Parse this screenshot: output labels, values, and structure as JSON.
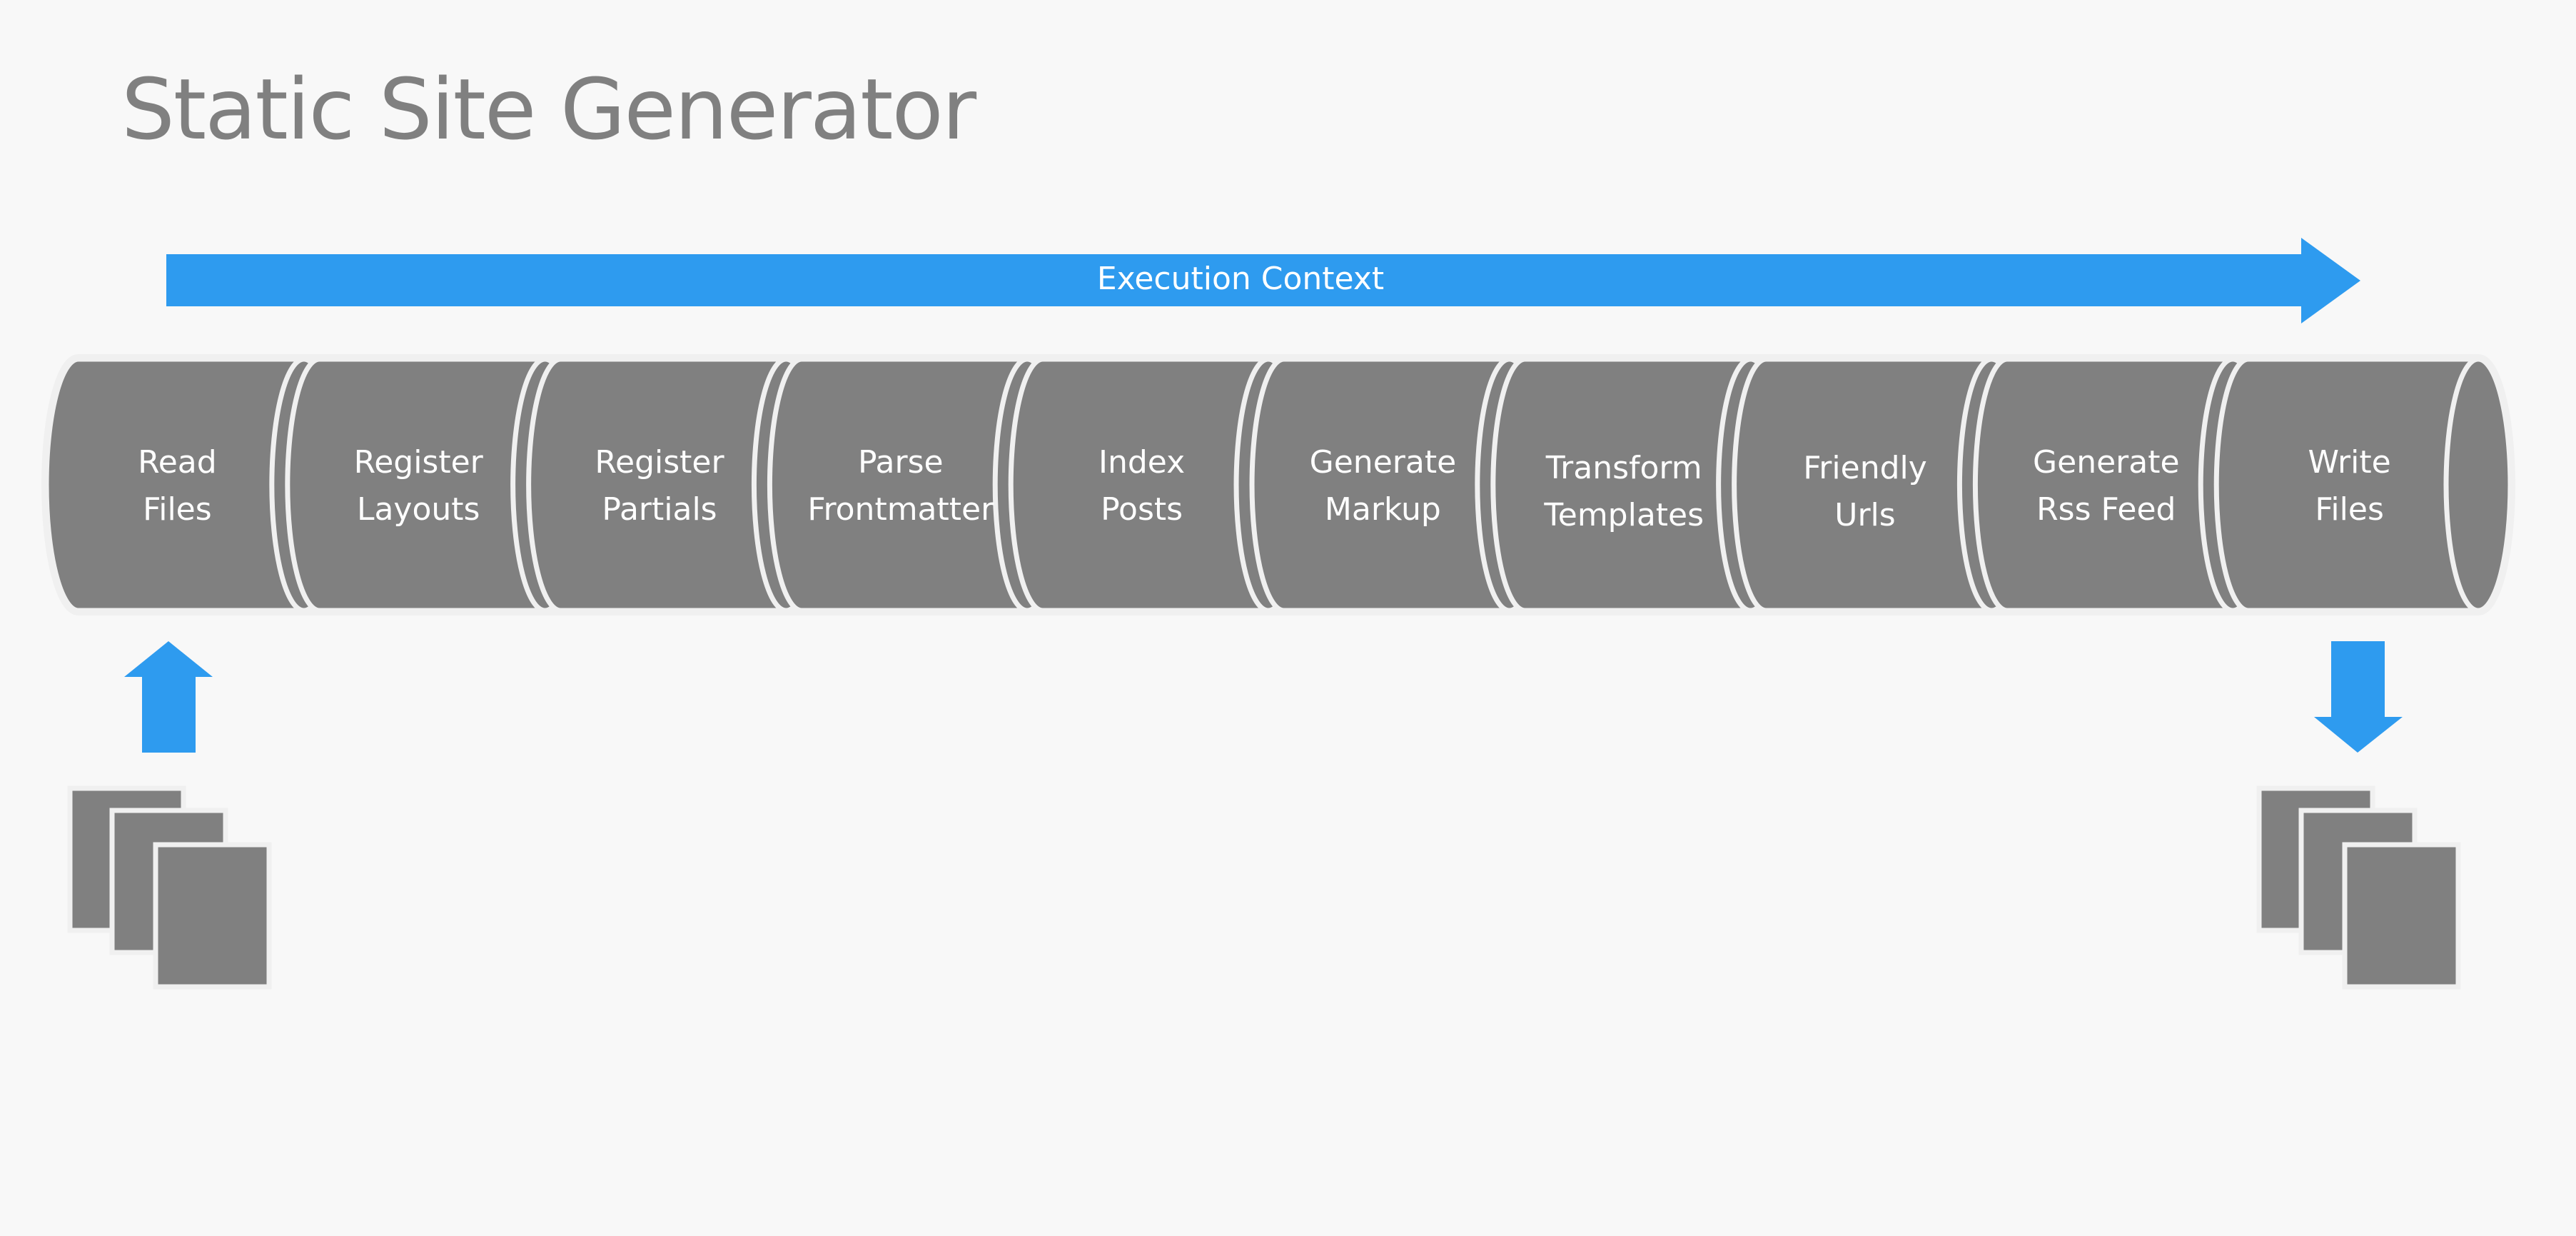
{
  "title": "Static Site Generator",
  "colors": {
    "background": "#f8f8f8",
    "accent_blue": "#2e9bef",
    "segment_fill": "#808080",
    "segment_stroke": "#f0f0f0",
    "title_text": "#808080",
    "label_text": "#ffffff"
  },
  "execution_context": {
    "label": "Execution Context",
    "direction": "right"
  },
  "pipeline": {
    "steps": [
      {
        "lines": [
          "Read",
          "Files"
        ]
      },
      {
        "lines": [
          "Register",
          "Layouts"
        ]
      },
      {
        "lines": [
          "Register",
          "Partials"
        ]
      },
      {
        "lines": [
          "Parse",
          "Frontmatter"
        ]
      },
      {
        "lines": [
          "Index",
          "Posts"
        ]
      },
      {
        "lines": [
          "Generate",
          "Markup"
        ]
      },
      {
        "lines": [
          "Transform",
          "Templates"
        ]
      },
      {
        "lines": [
          "Friendly",
          "Urls"
        ]
      },
      {
        "lines": [
          "Generate",
          "Rss Feed"
        ]
      },
      {
        "lines": [
          "Write",
          "Files"
        ]
      }
    ]
  },
  "input": {
    "icon": "documents-icon",
    "arrow": "arrow-up-icon",
    "count": 3
  },
  "output": {
    "icon": "documents-icon",
    "arrow": "arrow-down-icon",
    "count": 3
  }
}
